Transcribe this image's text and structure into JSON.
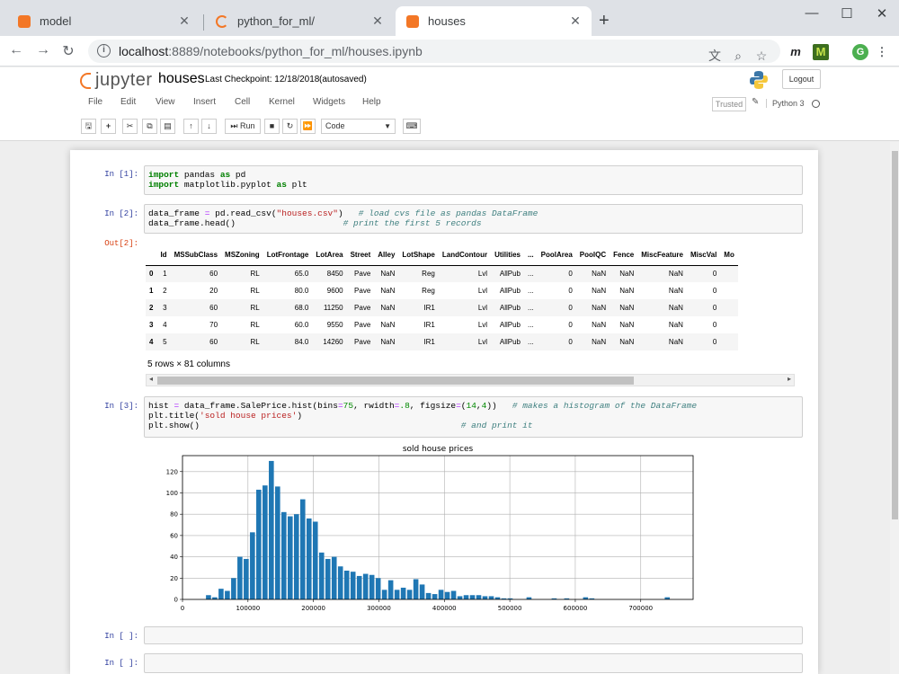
{
  "browser": {
    "tabs": [
      {
        "title": "model",
        "active": false
      },
      {
        "title": "python_for_ml/",
        "active": false
      },
      {
        "title": "houses",
        "active": true
      }
    ],
    "url_host": "localhost",
    "url_rest": ":8889/notebooks/python_for_ml/houses.ipynb",
    "ext_m_label": "m",
    "ext_M_label": "M",
    "profile_initial": "G"
  },
  "jupyter": {
    "logo_text": "jupyter",
    "notebook_name": "houses",
    "checkpoint": "Last Checkpoint: 12/18/2018",
    "autosaved": "(autosaved)",
    "logout": "Logout",
    "menu": [
      "File",
      "Edit",
      "View",
      "Insert",
      "Cell",
      "Kernel",
      "Widgets",
      "Help"
    ],
    "trusted": "Trusted",
    "kernel": "Python 3",
    "run_label": "Run",
    "cell_type": "Code"
  },
  "cells": {
    "c1": {
      "prompt": "In [1]:"
    },
    "c2": {
      "prompt": "In [2]:",
      "out_prompt": "Out[2]:"
    },
    "c3": {
      "prompt": "In [3]:"
    },
    "c4": {
      "prompt": "In [ ]:"
    },
    "c5": {
      "prompt": "In [ ]:"
    }
  },
  "dataframe": {
    "columns": [
      "",
      "Id",
      "MSSubClass",
      "MSZoning",
      "LotFrontage",
      "LotArea",
      "Street",
      "Alley",
      "LotShape",
      "LandContour",
      "Utilities",
      "...",
      "PoolArea",
      "PoolQC",
      "Fence",
      "MiscFeature",
      "MiscVal",
      "Mo"
    ],
    "rows": [
      [
        "0",
        "1",
        "60",
        "RL",
        "65.0",
        "8450",
        "Pave",
        "NaN",
        "Reg",
        "Lvl",
        "AllPub",
        "...",
        "0",
        "NaN",
        "NaN",
        "NaN",
        "0",
        ""
      ],
      [
        "1",
        "2",
        "20",
        "RL",
        "80.0",
        "9600",
        "Pave",
        "NaN",
        "Reg",
        "Lvl",
        "AllPub",
        "...",
        "0",
        "NaN",
        "NaN",
        "NaN",
        "0",
        ""
      ],
      [
        "2",
        "3",
        "60",
        "RL",
        "68.0",
        "11250",
        "Pave",
        "NaN",
        "IR1",
        "Lvl",
        "AllPub",
        "...",
        "0",
        "NaN",
        "NaN",
        "NaN",
        "0",
        ""
      ],
      [
        "3",
        "4",
        "70",
        "RL",
        "60.0",
        "9550",
        "Pave",
        "NaN",
        "IR1",
        "Lvl",
        "AllPub",
        "...",
        "0",
        "NaN",
        "NaN",
        "NaN",
        "0",
        ""
      ],
      [
        "4",
        "5",
        "60",
        "RL",
        "84.0",
        "14260",
        "Pave",
        "NaN",
        "IR1",
        "Lvl",
        "AllPub",
        "...",
        "0",
        "NaN",
        "NaN",
        "NaN",
        "0",
        ""
      ]
    ],
    "shape": "5 rows × 81 columns"
  },
  "chart_data": {
    "type": "bar",
    "title": "sold house prices",
    "xlabel": "",
    "ylabel": "",
    "xlim": [
      0,
      780000
    ],
    "ylim": [
      0,
      135
    ],
    "xticks": [
      0,
      100000,
      200000,
      300000,
      400000,
      500000,
      600000,
      700000
    ],
    "yticks": [
      0,
      20,
      40,
      60,
      80,
      100,
      120
    ],
    "grid": true,
    "bar_color": "#1f77b4",
    "bin_start": 34900,
    "bin_width": 9600,
    "values": [
      4,
      2,
      10,
      8,
      20,
      40,
      38,
      63,
      103,
      107,
      130,
      106,
      82,
      78,
      80,
      94,
      76,
      73,
      44,
      38,
      40,
      31,
      27,
      26,
      22,
      24,
      23,
      20,
      9,
      18,
      9,
      11,
      9,
      19,
      14,
      6,
      5,
      9,
      7,
      8,
      3,
      4,
      4,
      4,
      3,
      3,
      2,
      1,
      1,
      0,
      0,
      2,
      0,
      0,
      0,
      1,
      0,
      1,
      0,
      0,
      2,
      1,
      0,
      0,
      0,
      0,
      0,
      0,
      0,
      0,
      0,
      0,
      0,
      2,
      0
    ]
  }
}
